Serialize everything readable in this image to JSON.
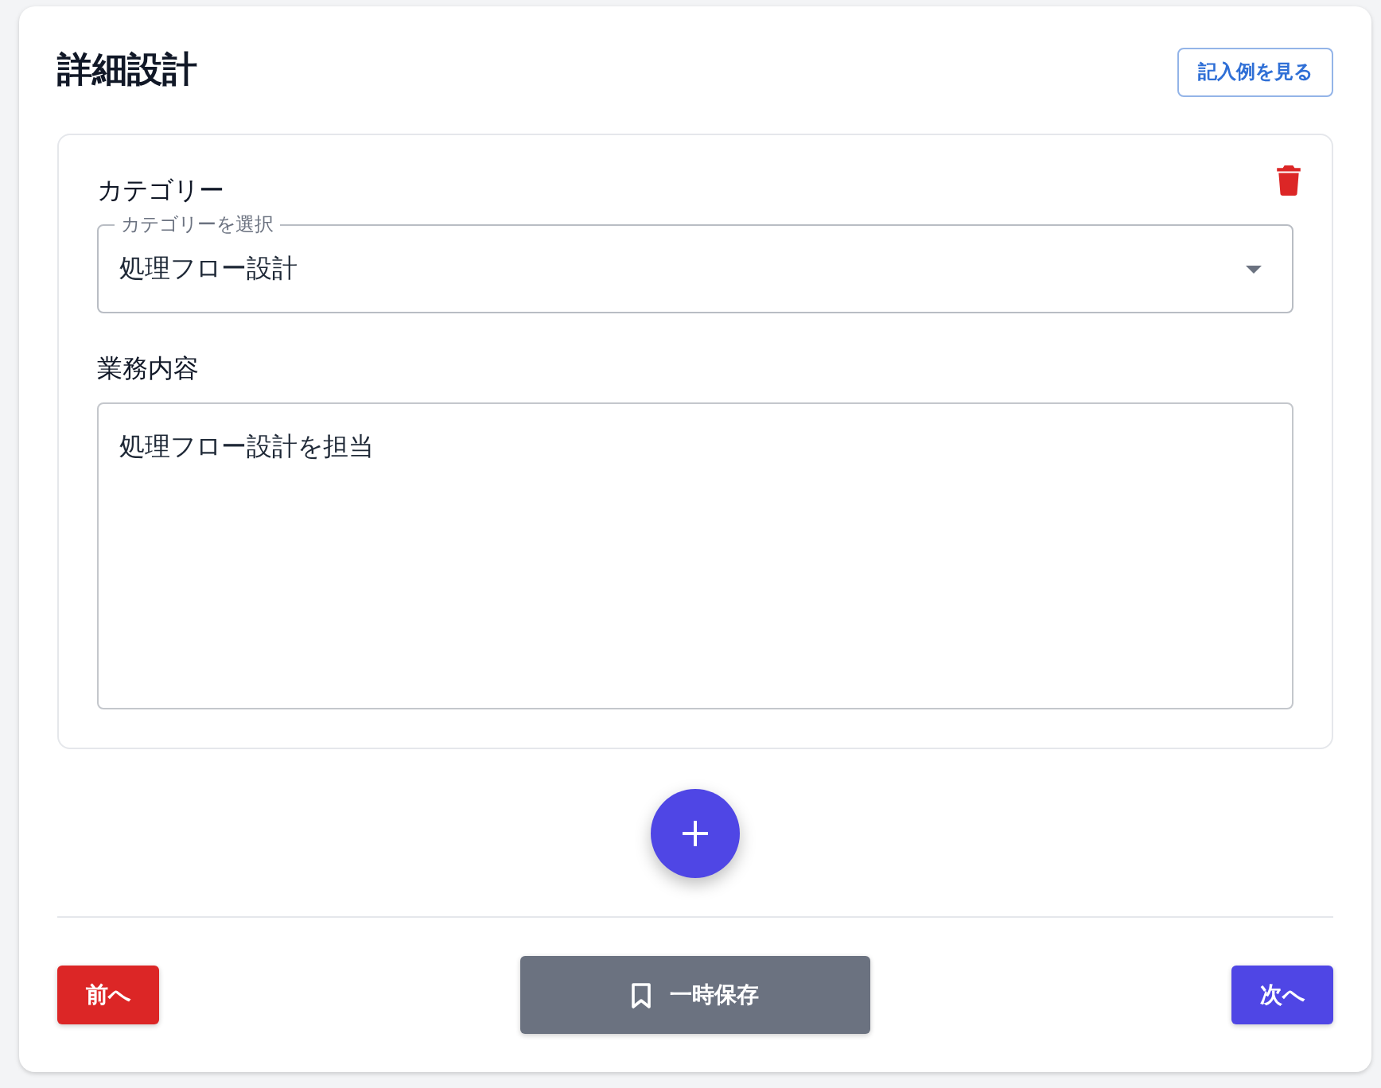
{
  "header": {
    "title": "詳細設計",
    "example_button": "記入例を見る"
  },
  "entries": [
    {
      "category": {
        "label": "カテゴリー",
        "floating_label": "カテゴリーを選択",
        "value": "処理フロー設計"
      },
      "description": {
        "label": "業務内容",
        "value": "処理フロー設計を担当"
      }
    }
  ],
  "footer": {
    "buttons": [
      {
        "kind": "back",
        "label": "前へ"
      },
      {
        "kind": "save",
        "label": "一時保存"
      },
      {
        "kind": "next",
        "label": "次へ"
      }
    ]
  }
}
